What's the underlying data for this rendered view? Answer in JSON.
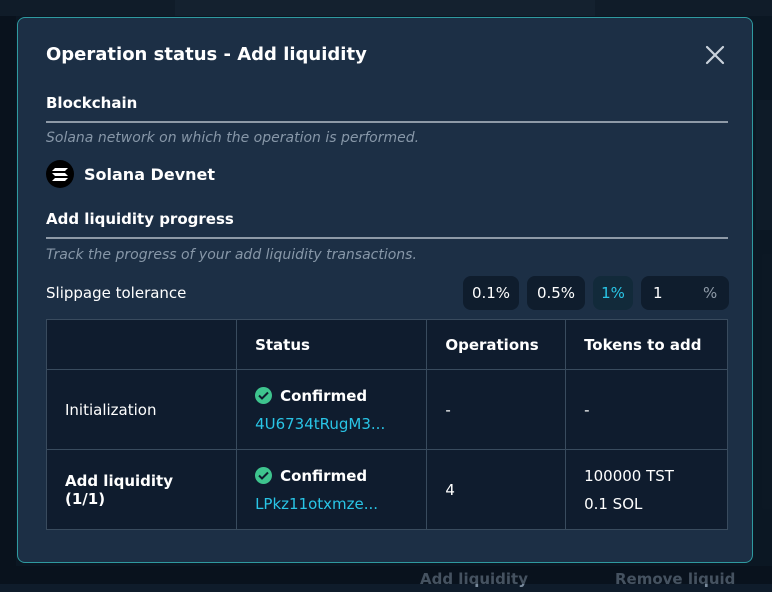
{
  "modal": {
    "title": "Operation status - Add liquidity"
  },
  "blockchain": {
    "title": "Blockchain",
    "description": "Solana network on which the operation is performed.",
    "network_name": "Solana Devnet",
    "network_icon": "solana-logo-icon"
  },
  "progress": {
    "title": "Add liquidity progress",
    "description": "Track the progress of your add liquidity transactions."
  },
  "slippage": {
    "label": "Slippage tolerance",
    "options": [
      "0.1%",
      "0.5%",
      "1%"
    ],
    "selected": "1%",
    "custom_value": "1",
    "unit": "%"
  },
  "table": {
    "headers": [
      "",
      "Status",
      "Operations",
      "Tokens to add"
    ],
    "rows": [
      {
        "step": "Initialization",
        "status": "Confirmed",
        "tx": "4U6734tRugM3...",
        "operations": "-",
        "tokens": [
          "-"
        ]
      },
      {
        "step": "Add liquidity (1/1)",
        "status": "Confirmed",
        "tx": "LPkz11otxmze...",
        "operations": "4",
        "tokens": [
          "100000 TST",
          "0.1 SOL"
        ]
      }
    ]
  },
  "background": {
    "buttons": [
      "Add liquidity",
      "Remove liquid"
    ]
  },
  "colors": {
    "accent": "#29c5e6",
    "success": "#3ec48e",
    "modal_bg": "#1c2f45",
    "border": "#2f9aa0"
  }
}
